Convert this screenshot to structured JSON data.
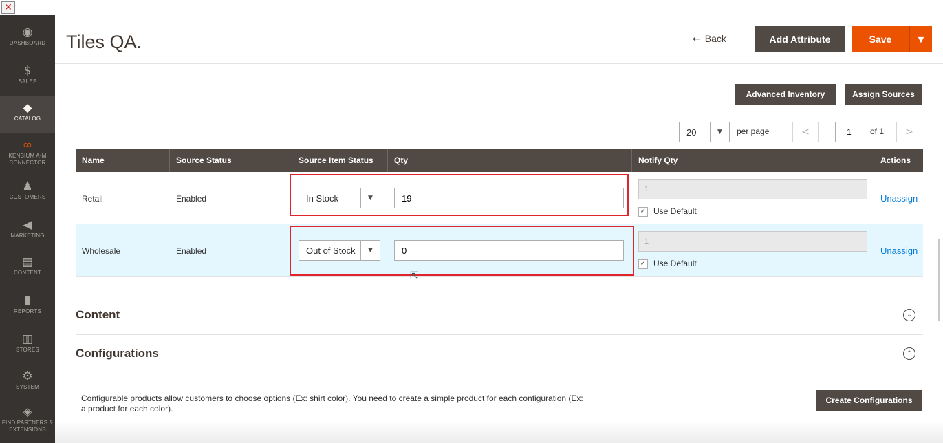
{
  "window": {
    "close_icon": "close-icon"
  },
  "sidebar": {
    "items": [
      {
        "icon": "dashboard-icon",
        "glyph": "◉",
        "label": "DASHBOARD"
      },
      {
        "icon": "dollar-icon",
        "glyph": "$",
        "label": "SALES"
      },
      {
        "icon": "cube-icon",
        "glyph": "◆",
        "label": "CATALOG",
        "active": true
      },
      {
        "icon": "infinity-icon",
        "glyph": "∞",
        "label": "KENSIUM A-M CONNECTOR"
      },
      {
        "icon": "person-icon",
        "glyph": "♟",
        "label": "CUSTOMERS"
      },
      {
        "icon": "megaphone-icon",
        "glyph": "◀",
        "label": "MARKETING"
      },
      {
        "icon": "content-icon",
        "glyph": "▤",
        "label": "CONTENT"
      },
      {
        "icon": "bar-chart-icon",
        "glyph": "▮",
        "label": "REPORTS"
      },
      {
        "icon": "store-icon",
        "glyph": "▥",
        "label": "STORES"
      },
      {
        "icon": "gear-icon",
        "glyph": "⚙",
        "label": "SYSTEM"
      },
      {
        "icon": "partners-icon",
        "glyph": "◈",
        "label": "FIND PARTNERS & EXTENSIONS"
      }
    ]
  },
  "header": {
    "title": "Tiles QA.",
    "back_arrow": "←",
    "back_label": "Back",
    "add_attribute": "Add Attribute",
    "save": "Save",
    "save_caret": "▼"
  },
  "toolbar": {
    "advanced_inventory": "Advanced Inventory",
    "assign_sources": "Assign Sources"
  },
  "pager": {
    "per_page_value": "20",
    "per_page_caret": "▼",
    "per_page_label": "per page",
    "prev": "<",
    "current_page": "1",
    "of_label": "of 1",
    "next": ">"
  },
  "grid": {
    "columns": [
      "Name",
      "Source Status",
      "Source Item Status",
      "Qty",
      "Notify Qty",
      "Actions"
    ],
    "rows": [
      {
        "name": "Retail",
        "source_status": "Enabled",
        "item_status": "In Stock",
        "qty": "19",
        "notify_qty": "1",
        "use_default": "Use Default",
        "action": "Unassign"
      },
      {
        "name": "Wholesale",
        "source_status": "Enabled",
        "item_status": "Out of Stock",
        "qty": "0",
        "notify_qty": "1",
        "use_default": "Use Default",
        "action": "Unassign"
      }
    ],
    "select_caret": "▼",
    "check_mark": "✓"
  },
  "sections": {
    "content": {
      "title": "Content",
      "toggle": "⌄"
    },
    "configurations": {
      "title": "Configurations",
      "toggle": "⌃"
    }
  },
  "configurations": {
    "description": "Configurable products allow customers to choose options (Ex: shirt color). You need to create a simple product for each configuration (Ex: a product for each color).",
    "create_button": "Create Configurations"
  },
  "colors": {
    "sidebar_bg": "#373330",
    "accent_orange": "#eb5202",
    "dark_button": "#514943",
    "link_blue": "#007bdb",
    "highlight_red": "#e0242b",
    "row_alt": "#e5f7fe"
  }
}
